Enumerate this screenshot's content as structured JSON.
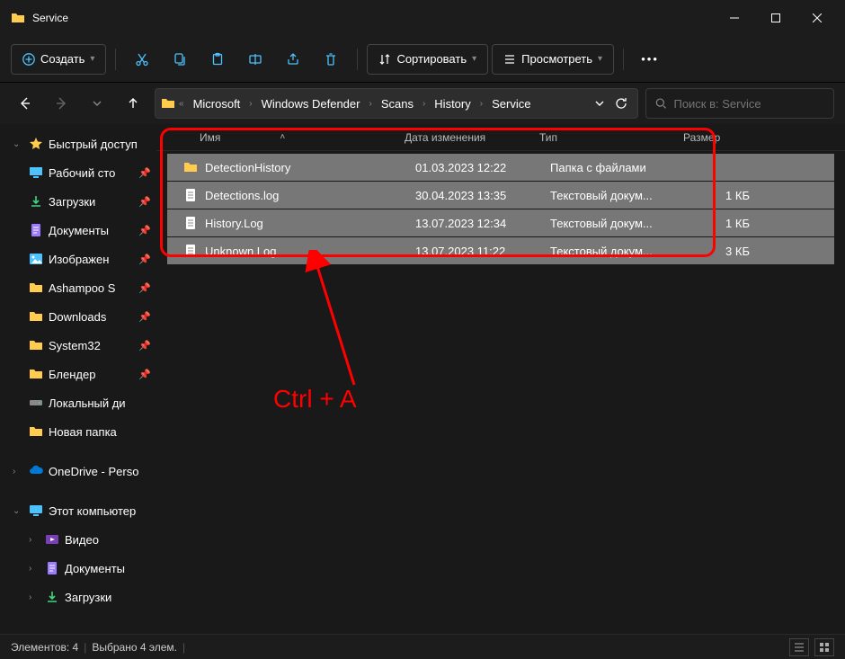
{
  "title": "Service",
  "toolbar": {
    "create": "Создать",
    "sort": "Сортировать",
    "view": "Просмотреть"
  },
  "breadcrumbs": [
    "Microsoft",
    "Windows Defender",
    "Scans",
    "History",
    "Service"
  ],
  "search": {
    "placeholder": "Поиск в: Service"
  },
  "columns": {
    "name": "Имя",
    "date": "Дата изменения",
    "type": "Тип",
    "size": "Размер"
  },
  "sidebar": {
    "quick": "Быстрый доступ",
    "items": [
      {
        "label": "Рабочий сто",
        "icon": "desktop",
        "pin": true
      },
      {
        "label": "Загрузки",
        "icon": "download",
        "pin": true
      },
      {
        "label": "Документы",
        "icon": "doc",
        "pin": true
      },
      {
        "label": "Изображен",
        "icon": "pic",
        "pin": true
      },
      {
        "label": "Ashampoo S",
        "icon": "folder",
        "pin": true
      },
      {
        "label": "Downloads",
        "icon": "folder",
        "pin": true
      },
      {
        "label": "System32",
        "icon": "folder",
        "pin": true
      },
      {
        "label": "Блендер",
        "icon": "folder",
        "pin": true
      },
      {
        "label": "Локальный ди",
        "icon": "drive",
        "pin": false
      },
      {
        "label": "Новая папка",
        "icon": "folder",
        "pin": false
      }
    ],
    "onedrive": "OneDrive - Perso",
    "thispc": "Этот компьютер",
    "pcitems": [
      {
        "label": "Видео",
        "icon": "video"
      },
      {
        "label": "Документы",
        "icon": "doc"
      },
      {
        "label": "Загрузки",
        "icon": "download"
      }
    ]
  },
  "files": [
    {
      "name": "DetectionHistory",
      "date": "01.03.2023 12:22",
      "type": "Папка с файлами",
      "size": "",
      "icon": "folder"
    },
    {
      "name": "Detections.log",
      "date": "30.04.2023 13:35",
      "type": "Текстовый докум...",
      "size": "1 КБ",
      "icon": "file"
    },
    {
      "name": "History.Log",
      "date": "13.07.2023 12:34",
      "type": "Текстовый докум...",
      "size": "1 КБ",
      "icon": "file"
    },
    {
      "name": "Unknown.Log",
      "date": "13.07.2023 11:22",
      "type": "Текстовый докум...",
      "size": "3 КБ",
      "icon": "file"
    }
  ],
  "status": {
    "count": "Элементов: 4",
    "selected": "Выбрано 4 элем."
  },
  "annotation": "Ctrl + A"
}
